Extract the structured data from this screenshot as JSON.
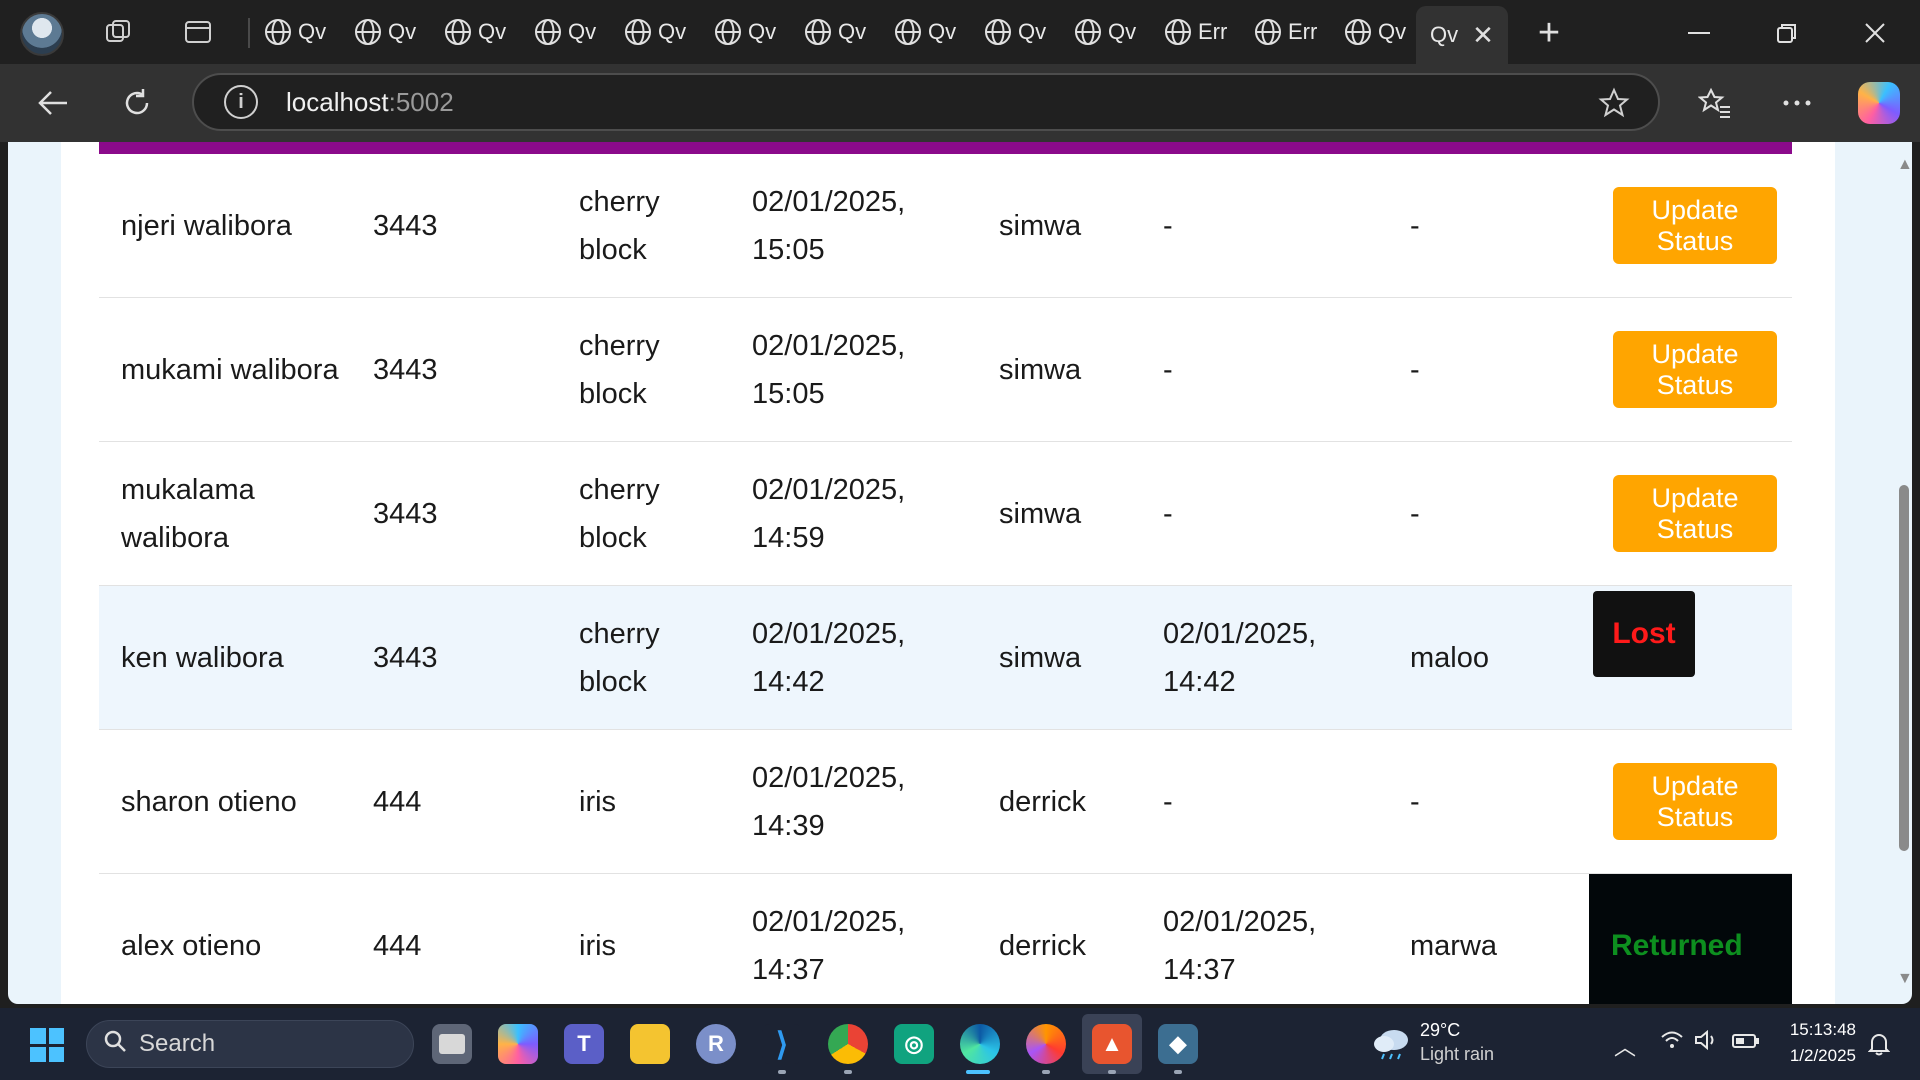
{
  "browser": {
    "tabs": [
      {
        "label": "Qv"
      },
      {
        "label": "Qv"
      },
      {
        "label": "Qv"
      },
      {
        "label": "Qv"
      },
      {
        "label": "Qv"
      },
      {
        "label": "Qv"
      },
      {
        "label": "Qv"
      },
      {
        "label": "Qv"
      },
      {
        "label": "Qv"
      },
      {
        "label": "Qv"
      },
      {
        "label": "Err"
      },
      {
        "label": "Err"
      },
      {
        "label": "Qv"
      },
      {
        "label": "Qv"
      }
    ],
    "new_tab_label": "+",
    "url_host": "localhost",
    "url_port": ":5002",
    "colors": {
      "chrome": "#202020",
      "toolbar": "#323232"
    }
  },
  "table": {
    "rows": [
      {
        "name": "njeri walibora",
        "number": "3443",
        "block": "cherry block",
        "time_in": "02/01/2025, 15:05",
        "registered_by": "simwa",
        "time_out": "-",
        "cleared_by": "-",
        "action": "update",
        "action_label": "Update Status"
      },
      {
        "name": "mukami walibora",
        "number": "3443",
        "block": "cherry block",
        "time_in": "02/01/2025, 15:05",
        "registered_by": "simwa",
        "time_out": "-",
        "cleared_by": "-",
        "action": "update",
        "action_label": "Update Status"
      },
      {
        "name": "mukalama walibora",
        "number": "3443",
        "block": "cherry block",
        "time_in": "02/01/2025, 14:59",
        "registered_by": "simwa",
        "time_out": "-",
        "cleared_by": "-",
        "action": "update",
        "action_label": "Update Status"
      },
      {
        "name": "ken walibora",
        "number": "3443",
        "block": "cherry block",
        "time_in": "02/01/2025, 14:42",
        "registered_by": "simwa",
        "time_out": "02/01/2025, 14:42",
        "cleared_by": "maloo",
        "action": "lost",
        "action_label": "Lost"
      },
      {
        "name": "sharon otieno",
        "number": "444",
        "block": "iris",
        "time_in": "02/01/2025, 14:39",
        "registered_by": "derrick",
        "time_out": "-",
        "cleared_by": "-",
        "action": "update",
        "action_label": "Update Status"
      },
      {
        "name": "alex otieno",
        "number": "444",
        "block": "iris",
        "time_in": "02/01/2025, 14:37",
        "registered_by": "derrick",
        "time_out": "02/01/2025, 14:37",
        "cleared_by": "marwa",
        "action": "returned",
        "action_label": "Returned"
      }
    ],
    "colors": {
      "accent_strip": "#8b0a8b",
      "update_button": "#ffa500",
      "lost_text": "#ff1a1a",
      "returned_text": "#0d8f1f"
    }
  },
  "taskbar": {
    "search_label": "Search",
    "weather_temp": "29°C",
    "weather_desc": "Light rain",
    "clock_time": "15:13:48",
    "clock_date": "1/2/2025"
  }
}
